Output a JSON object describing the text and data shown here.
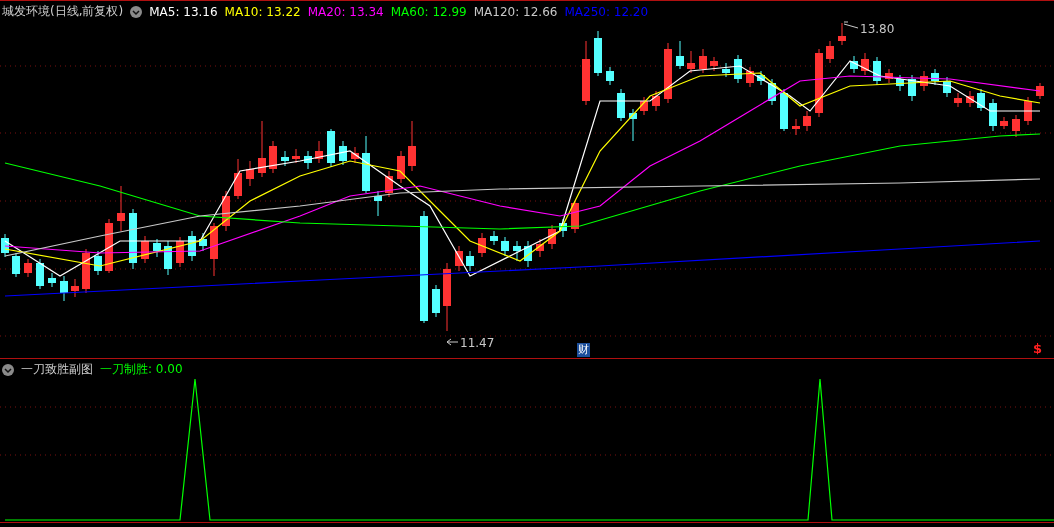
{
  "main_chart": {
    "title": "城发环境(日线,前复权)",
    "indicators": [
      {
        "label": "MA5: 13.16",
        "color": "#ffffff"
      },
      {
        "label": "MA10: 13.22",
        "color": "#ffff00"
      },
      {
        "label": "MA20: 13.34",
        "color": "#ff00ff"
      },
      {
        "label": "MA60: 12.99",
        "color": "#00ff00"
      },
      {
        "label": "MA120: 12.66",
        "color": "#c8c8c8"
      },
      {
        "label": "MA250: 12.20",
        "color": "#0000ff"
      }
    ],
    "high_label": "13.80",
    "low_label": "11.47",
    "finance_badge": "财",
    "marker": "$"
  },
  "sub_chart": {
    "title": "一刀致胜副图",
    "indicators": [
      {
        "label": "一刀制胜: 0.00",
        "color": "#00ff00"
      }
    ]
  }
}
